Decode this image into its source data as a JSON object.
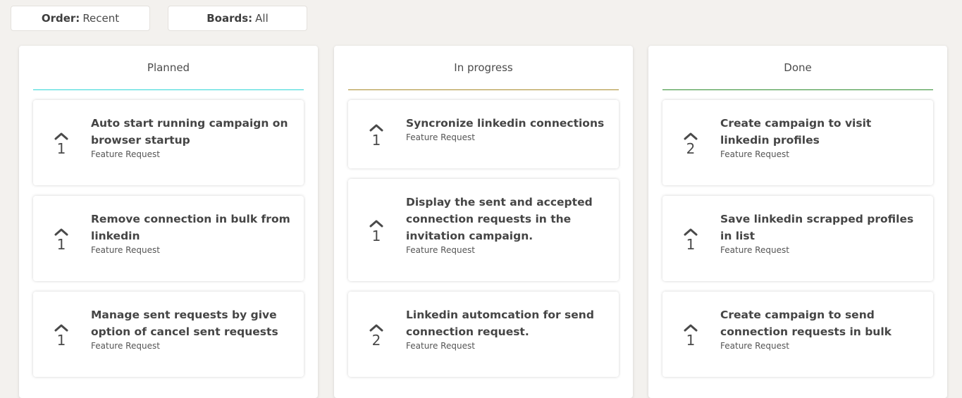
{
  "filters": {
    "order": {
      "label": "Order:",
      "value": "Recent"
    },
    "boards": {
      "label": "Boards:",
      "value": "All"
    }
  },
  "columns": [
    {
      "title": "Planned",
      "accent": "#2fd6d6",
      "cards": [
        {
          "votes": "1",
          "title": "Auto start running campaign on browser startup",
          "category": "Feature Request"
        },
        {
          "votes": "1",
          "title": "Remove connection in bulk from linkedin",
          "category": "Feature Request"
        },
        {
          "votes": "1",
          "title": "Manage sent requests by give option of cancel sent requests",
          "category": "Feature Request"
        }
      ]
    },
    {
      "title": "In progress",
      "accent": "#a88a2a",
      "cards": [
        {
          "votes": "1",
          "title": "Syncronize linkedin connections",
          "category": "Feature Request"
        },
        {
          "votes": "1",
          "title": "Display the sent and accepted connection requests in the invitation campaign.",
          "category": "Feature Request"
        },
        {
          "votes": "2",
          "title": "Linkedin automcation for send connection request.",
          "category": "Feature Request"
        }
      ]
    },
    {
      "title": "Done",
      "accent": "#2e8b2e",
      "cards": [
        {
          "votes": "2",
          "title": "Create campaign to visit linkedin profiles",
          "category": "Feature Request"
        },
        {
          "votes": "1",
          "title": "Save linkedin scrapped profiles in list",
          "category": "Feature Request"
        },
        {
          "votes": "1",
          "title": "Create campaign to send connection requests in bulk",
          "category": "Feature Request"
        }
      ]
    }
  ]
}
